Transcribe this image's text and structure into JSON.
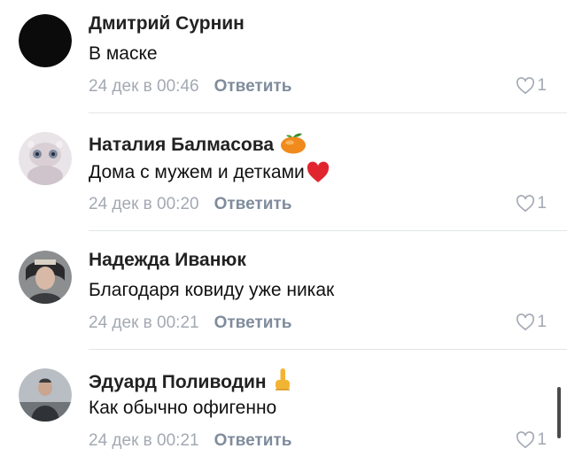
{
  "comments": [
    {
      "author": "Дмитрий Сурнин",
      "text": "В маске",
      "date": "24 дек в 00:46",
      "reply_label": "Ответить",
      "likes": "1"
    },
    {
      "author": "Наталия Балмасова",
      "text": "Дома с мужем и детками",
      "date": "24 дек в 00:20",
      "reply_label": "Ответить",
      "likes": "1",
      "emoji": "tangerine-emoji",
      "text_emoji": "red-heart-emoji"
    },
    {
      "author": "Надежда Иванюк",
      "text": "Благодаря ковиду уже никак",
      "date": "24 дек в 00:21",
      "reply_label": "Ответить",
      "likes": "1"
    },
    {
      "author": "Эдуард Поливодин",
      "text": "Как обычно офигенно",
      "date": "24 дек в 00:21",
      "reply_label": "Ответить",
      "likes": "1",
      "emoji": "raised-finger-emoji"
    }
  ],
  "colors": {
    "author": "#222222",
    "date": "#a3a9b2",
    "reply": "#7f8c9c",
    "divider": "#e3e6ea",
    "heart": "#e0252f",
    "tangerine": "#f08a1c"
  }
}
